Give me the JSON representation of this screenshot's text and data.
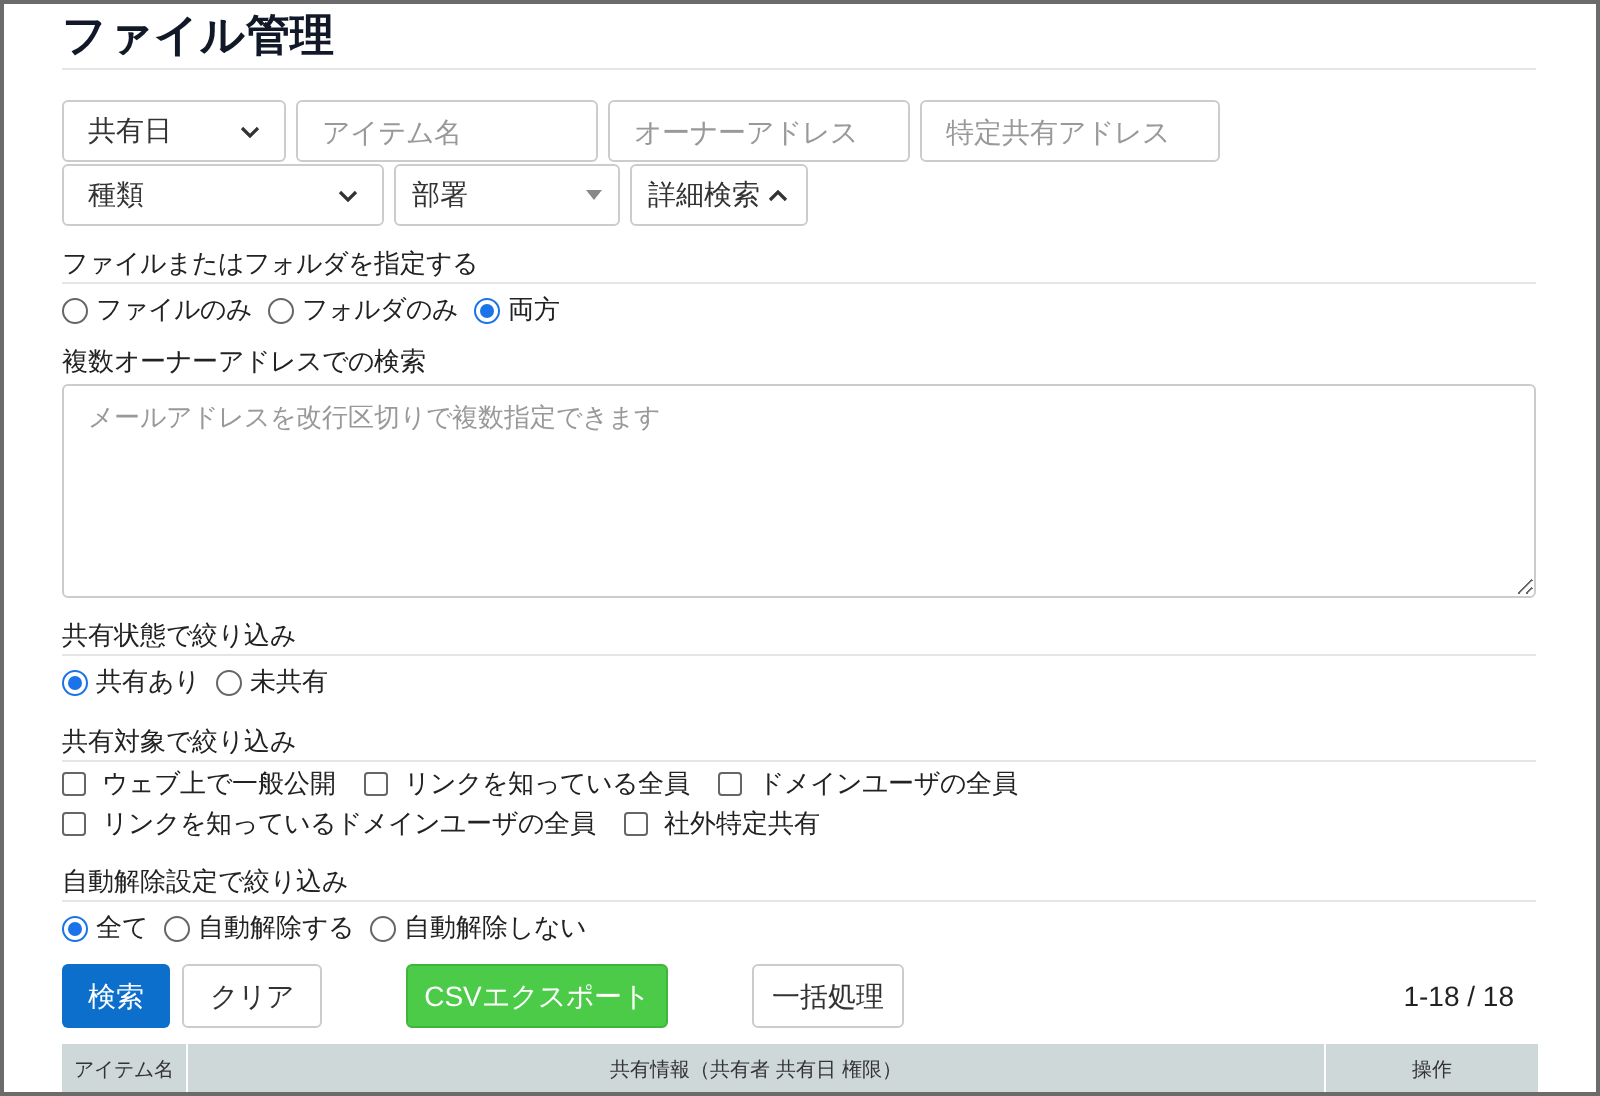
{
  "title": "ファイル管理",
  "filters_row1": [
    {
      "kind": "select",
      "value": "共有日"
    },
    {
      "kind": "input",
      "placeholder": "アイテム名"
    },
    {
      "kind": "input",
      "placeholder": "オーナーアドレス"
    },
    {
      "kind": "input",
      "placeholder": "特定共有アドレス"
    }
  ],
  "filters_row2": [
    {
      "kind": "select",
      "value": "種類"
    },
    {
      "kind": "dropdown",
      "value": "部署"
    },
    {
      "kind": "toggle",
      "label": "詳細検索",
      "expanded": true
    }
  ],
  "target": {
    "label": "ファイルまたはフォルダを指定する",
    "options": [
      {
        "label": "ファイルのみ",
        "selected": false
      },
      {
        "label": "フォルダのみ",
        "selected": false
      },
      {
        "label": "両方",
        "selected": true
      }
    ]
  },
  "multi_owner": {
    "label": "複数オーナーアドレスでの検索",
    "placeholder": "メールアドレスを改行区切りで複数指定できます"
  },
  "share_status": {
    "label": "共有状態で絞り込み",
    "options": [
      {
        "label": "共有あり",
        "selected": true
      },
      {
        "label": "未共有",
        "selected": false
      }
    ]
  },
  "share_target": {
    "label": "共有対象で絞り込み",
    "options": [
      {
        "label": "ウェブ上で一般公開",
        "checked": false
      },
      {
        "label": "リンクを知っている全員",
        "checked": false
      },
      {
        "label": "ドメインユーザの全員",
        "checked": false
      },
      {
        "label": "リンクを知っているドメインユーザの全員",
        "checked": false
      },
      {
        "label": "社外特定共有",
        "checked": false
      }
    ]
  },
  "auto_release": {
    "label": "自動解除設定で絞り込み",
    "options": [
      {
        "label": "全て",
        "selected": true
      },
      {
        "label": "自動解除する",
        "selected": false
      },
      {
        "label": "自動解除しない",
        "selected": false
      }
    ]
  },
  "buttons": {
    "search": "検索",
    "clear": "クリア",
    "export": "CSVエクスポート",
    "bulk": "一括処理"
  },
  "count": "1-18 / 18",
  "table": {
    "columns": [
      "アイテム名",
      "共有情報（共有者 共有日 権限）",
      "操作"
    ]
  }
}
